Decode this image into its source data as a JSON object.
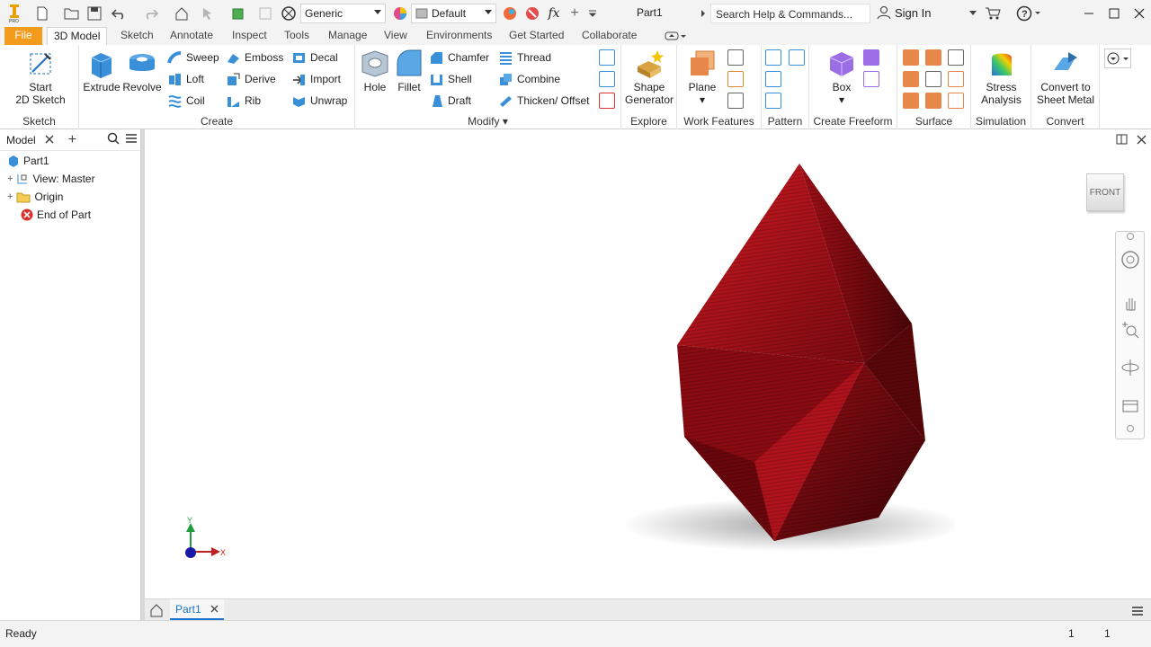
{
  "qat": {
    "appearance_value": "Generic",
    "material_value": "Default",
    "fx_label": "fx",
    "doc_title": "Part1",
    "search_placeholder": "Search Help & Commands...",
    "sign_in": "Sign In"
  },
  "tabs": [
    "File",
    "3D Model",
    "Sketch",
    "Annotate",
    "Inspect",
    "Tools",
    "Manage",
    "View",
    "Environments",
    "Get Started",
    "Collaborate"
  ],
  "active_tab": "3D Model",
  "ribbon": {
    "sketch": {
      "title": "Sketch",
      "start_sketch_1": "Start",
      "start_sketch_2": "2D Sketch"
    },
    "create": {
      "title": "Create",
      "extrude": "Extrude",
      "revolve": "Revolve",
      "sweep": "Sweep",
      "emboss": "Emboss",
      "decal": "Decal",
      "loft": "Loft",
      "derive": "Derive",
      "import": "Import",
      "coil": "Coil",
      "rib": "Rib",
      "unwrap": "Unwrap"
    },
    "modify": {
      "title": "Modify",
      "hole": "Hole",
      "fillet": "Fillet",
      "chamfer": "Chamfer",
      "thread": "Thread",
      "shell": "Shell",
      "combine": "Combine",
      "draft": "Draft",
      "thicken": "Thicken/ Offset"
    },
    "explore": {
      "title": "Explore",
      "shape_gen_1": "Shape",
      "shape_gen_2": "Generator"
    },
    "work": {
      "title": "Work Features",
      "plane": "Plane"
    },
    "pattern": {
      "title": "Pattern"
    },
    "freeform": {
      "title": "Create Freeform",
      "box": "Box"
    },
    "surface": {
      "title": "Surface"
    },
    "simulation": {
      "title": "Simulation",
      "stress_1": "Stress",
      "stress_2": "Analysis"
    },
    "convert": {
      "title": "Convert",
      "convert_1": "Convert to",
      "convert_2": "Sheet Metal"
    }
  },
  "browser": {
    "title": "Model",
    "items": [
      "Part1",
      "View: Master",
      "Origin",
      "End of Part"
    ]
  },
  "viewport": {
    "viewcube_label": "FRONT",
    "axis_x": "X",
    "axis_y": "Y"
  },
  "doc_tab": "Part1",
  "status": {
    "text": "Ready",
    "num1": "1",
    "num2": "1"
  },
  "colors": {
    "file_tab": "#f39b1c",
    "model_red": "#b0101a",
    "accent_blue": "#1a73c9"
  }
}
